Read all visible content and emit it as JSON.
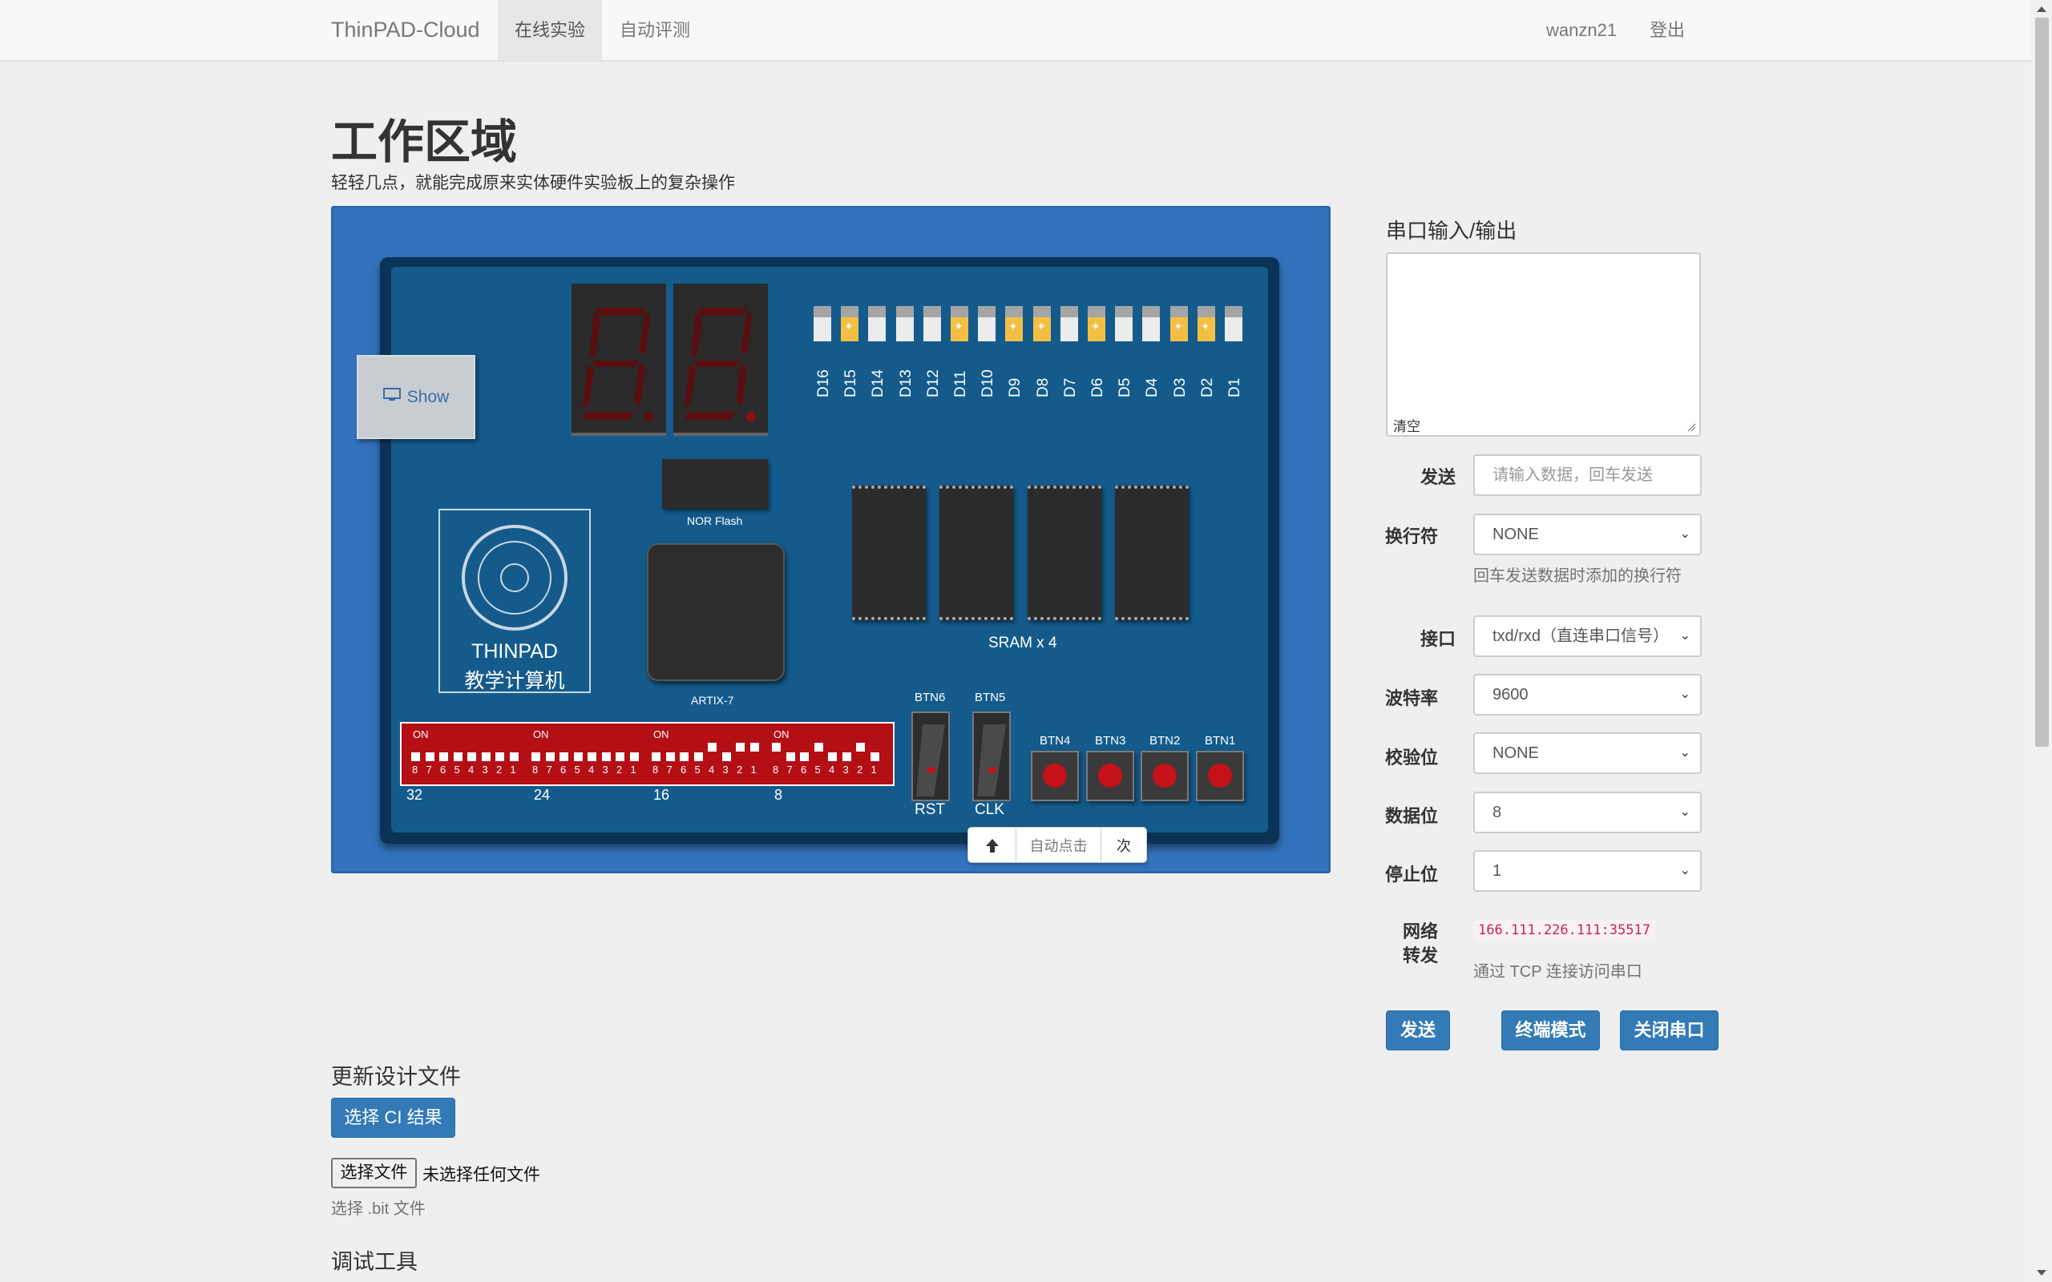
{
  "navbar": {
    "brand": "ThinPAD-Cloud",
    "items": [
      {
        "label": "在线实验",
        "active": true
      },
      {
        "label": "自动评测",
        "active": false
      }
    ],
    "user": "wanzn21",
    "logout": "登出"
  },
  "page": {
    "title": "工作区域",
    "subtitle": "轻轻几点，就能完成原来实体硬件实验板上的复杂操作"
  },
  "board": {
    "show_label": "Show",
    "leds": [
      {
        "label": "D16",
        "on": false
      },
      {
        "label": "D15",
        "on": true
      },
      {
        "label": "D14",
        "on": false
      },
      {
        "label": "D13",
        "on": false
      },
      {
        "label": "D12",
        "on": false
      },
      {
        "label": "D11",
        "on": true
      },
      {
        "label": "D10",
        "on": false
      },
      {
        "label": "D9",
        "on": true
      },
      {
        "label": "D8",
        "on": true
      },
      {
        "label": "D7",
        "on": false
      },
      {
        "label": "D6",
        "on": true
      },
      {
        "label": "D5",
        "on": false
      },
      {
        "label": "D4",
        "on": false
      },
      {
        "label": "D3",
        "on": true
      },
      {
        "label": "D2",
        "on": true
      },
      {
        "label": "D1",
        "on": false
      }
    ],
    "nor_flash_label": "NOR Flash",
    "fpga_label": "ARTIX-7",
    "sram_label": "SRAM x 4",
    "logo_line1": "THINPAD",
    "logo_line2": "教学计算机",
    "dip_on": "ON",
    "dip_digits": "87654321",
    "dip_group_labels": [
      "32",
      "24",
      "16",
      "8"
    ],
    "rocker_buttons": [
      {
        "top_label": "BTN6",
        "bottom_label": "RST"
      },
      {
        "top_label": "BTN5",
        "bottom_label": "CLK"
      }
    ],
    "push_buttons": [
      "BTN4",
      "BTN3",
      "BTN2",
      "BTN1"
    ],
    "toolbar": {
      "auto_click": "自动点击",
      "times": "次"
    }
  },
  "serial": {
    "title": "串口输入/输出",
    "clear": "清空",
    "send_label": "发送",
    "send_placeholder": "请输入数据，回车发送",
    "newline_label": "换行符",
    "newline_value": "NONE",
    "newline_help": "回车发送数据时添加的换行符",
    "port_label": "接口",
    "port_value": "txd/rxd（直连串口信号）",
    "baud_label": "波特率",
    "baud_value": "9600",
    "parity_label": "校验位",
    "parity_value": "NONE",
    "databits_label": "数据位",
    "databits_value": "8",
    "stopbits_label": "停止位",
    "stopbits_value": "1",
    "forward_label_1": "网络",
    "forward_label_2": "转发",
    "forward_address": "166.111.226.111:35517",
    "forward_help": "通过 TCP 连接访问串口",
    "send_button": "发送",
    "terminal_button": "终端模式",
    "close_button": "关闭串口"
  },
  "design": {
    "title": "更新设计文件",
    "ci_button": "选择 CI 结果",
    "file_button": "选择文件",
    "file_none": "未选择任何文件",
    "file_help": "选择 .bit 文件"
  },
  "debug": {
    "title": "调试工具"
  },
  "colors": {
    "primary": "#337ab7",
    "board_bg": "#3373bd",
    "pcb": "#145b8c",
    "led_on": "#f3c044",
    "dip_red": "#b30f14"
  }
}
